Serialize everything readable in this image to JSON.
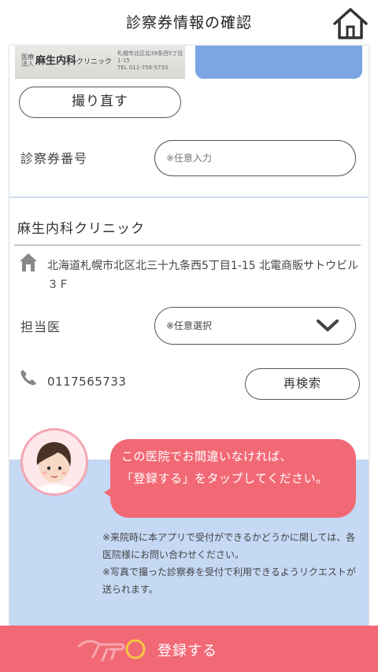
{
  "header": {
    "title": "診察券情報の確認",
    "home_icon": "home-icon"
  },
  "card_photo": {
    "corp_label": "医療\n法人",
    "clinic_name": "麻生内科",
    "clinic_suffix": "クリニック",
    "address_line1": "札幌市北区北39条西5丁目1-15",
    "address_line2": "TEL 011-756-5733"
  },
  "buttons": {
    "retake": "撮り直す",
    "research": "再検索",
    "register": "登録する"
  },
  "card_number": {
    "label": "診察券番号",
    "placeholder": "※任意入力"
  },
  "clinic": {
    "name": "麻生内科クリニック",
    "address": "北海道札幌市北区北三十九条西5丁目1-15 北電商販サトウビル３Ｆ",
    "doctor_label": "担当医",
    "doctor_select": "※任意選択",
    "phone": "0117565733"
  },
  "guide": {
    "message_line1": "この医院でお間違いなければ、",
    "message_line2": "「登録する」をタップしてください。",
    "note1": "※来院時に本アプリで受付ができるかどうかに関しては、各医院様にお問い合わせください。",
    "note2": "※写真で撮った診察券を受付で利用できるようリクエストが送られます。"
  },
  "colors": {
    "accent_pink": "#f26976",
    "panel_blue": "#c5d8f4",
    "button_blue": "#7ba6e3"
  }
}
